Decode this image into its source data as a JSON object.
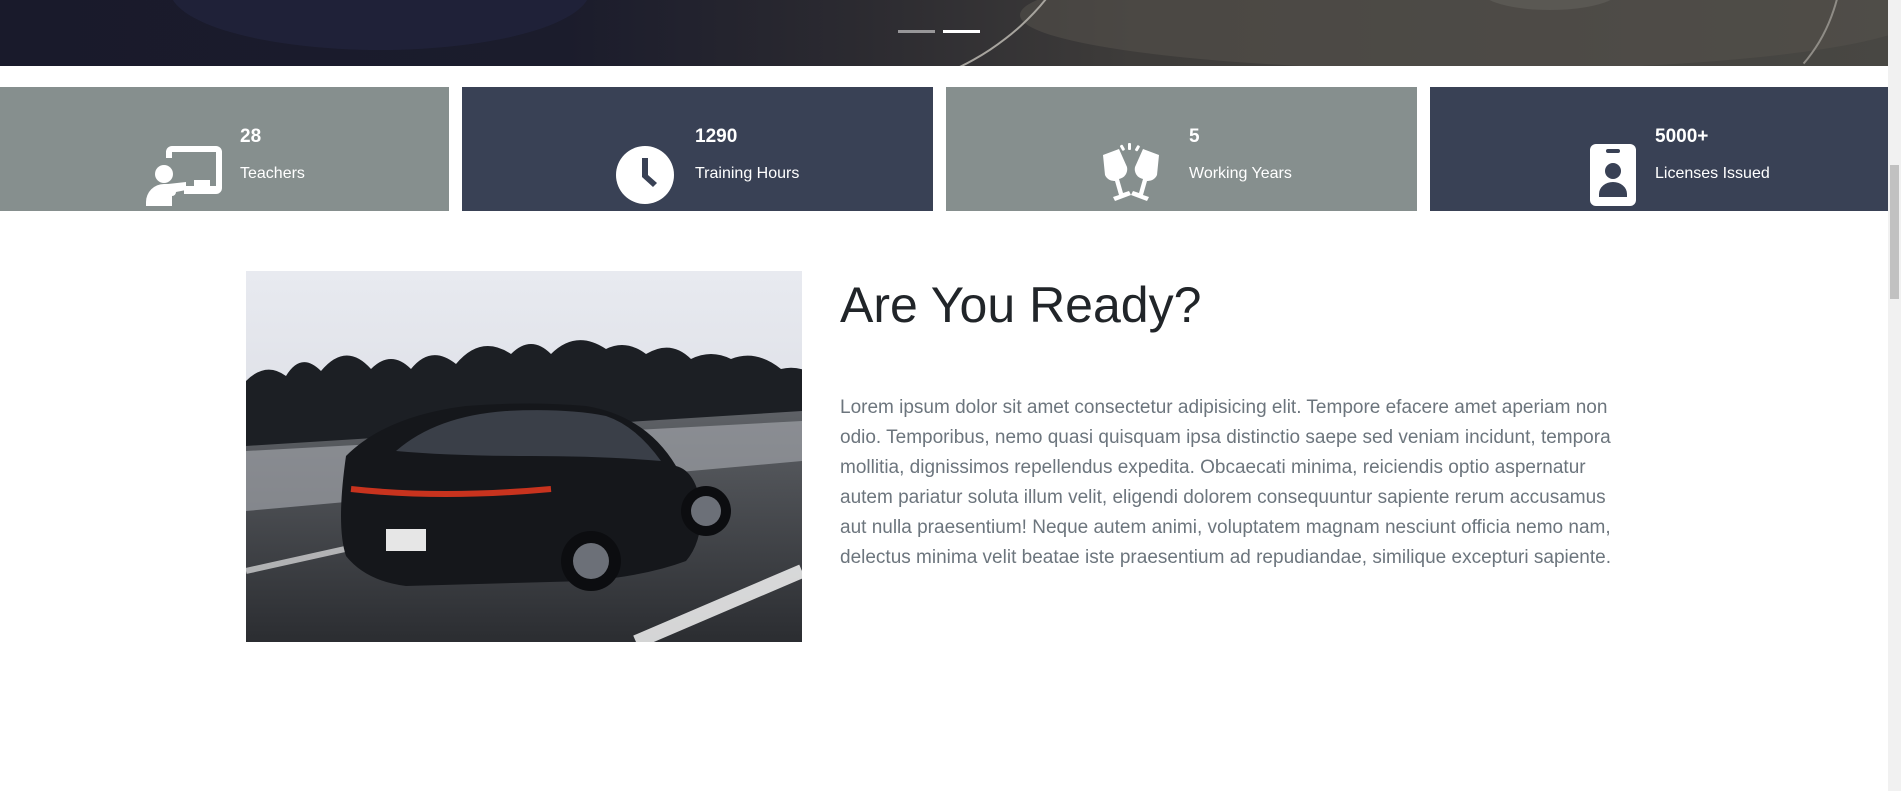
{
  "carousel": {
    "indicators": [
      {
        "label": "Slide 1",
        "active": false
      },
      {
        "label": "Slide 2",
        "active": true
      }
    ]
  },
  "stats": [
    {
      "number": "28",
      "label": "Teachers",
      "icon": "chalkboard-teacher-icon",
      "color": "#868f8e"
    },
    {
      "number": "1290",
      "label": "Training Hours",
      "icon": "clock-icon",
      "color": "#394155"
    },
    {
      "number": "5",
      "label": "Working Years",
      "icon": "glass-cheers-icon",
      "color": "#868f8e"
    },
    {
      "number": "5000+",
      "label": "Licenses Issued",
      "icon": "id-badge-icon",
      "color": "#394155"
    }
  ],
  "about": {
    "title": "Are You Ready?",
    "text": "Lorem ipsum dolor sit amet consectetur adipisicing elit. Tempore efacere amet aperiam non odio. Temporibus, nemo quasi quisquam ipsa distinctio saepe sed veniam incidunt, tempora mollitia, dignissimos repellendus expedita. Obcaecati minima, reiciendis optio aspernatur autem pariatur soluta illum velit, eligendi dolorem consequuntur sapiente rerum accusamus aut nulla praesentium! Neque autem animi, voluptatem magnam nesciunt officia nemo nam, delectus minima velit beatae iste praesentium ad repudiandae, similique excepturi sapiente."
  }
}
